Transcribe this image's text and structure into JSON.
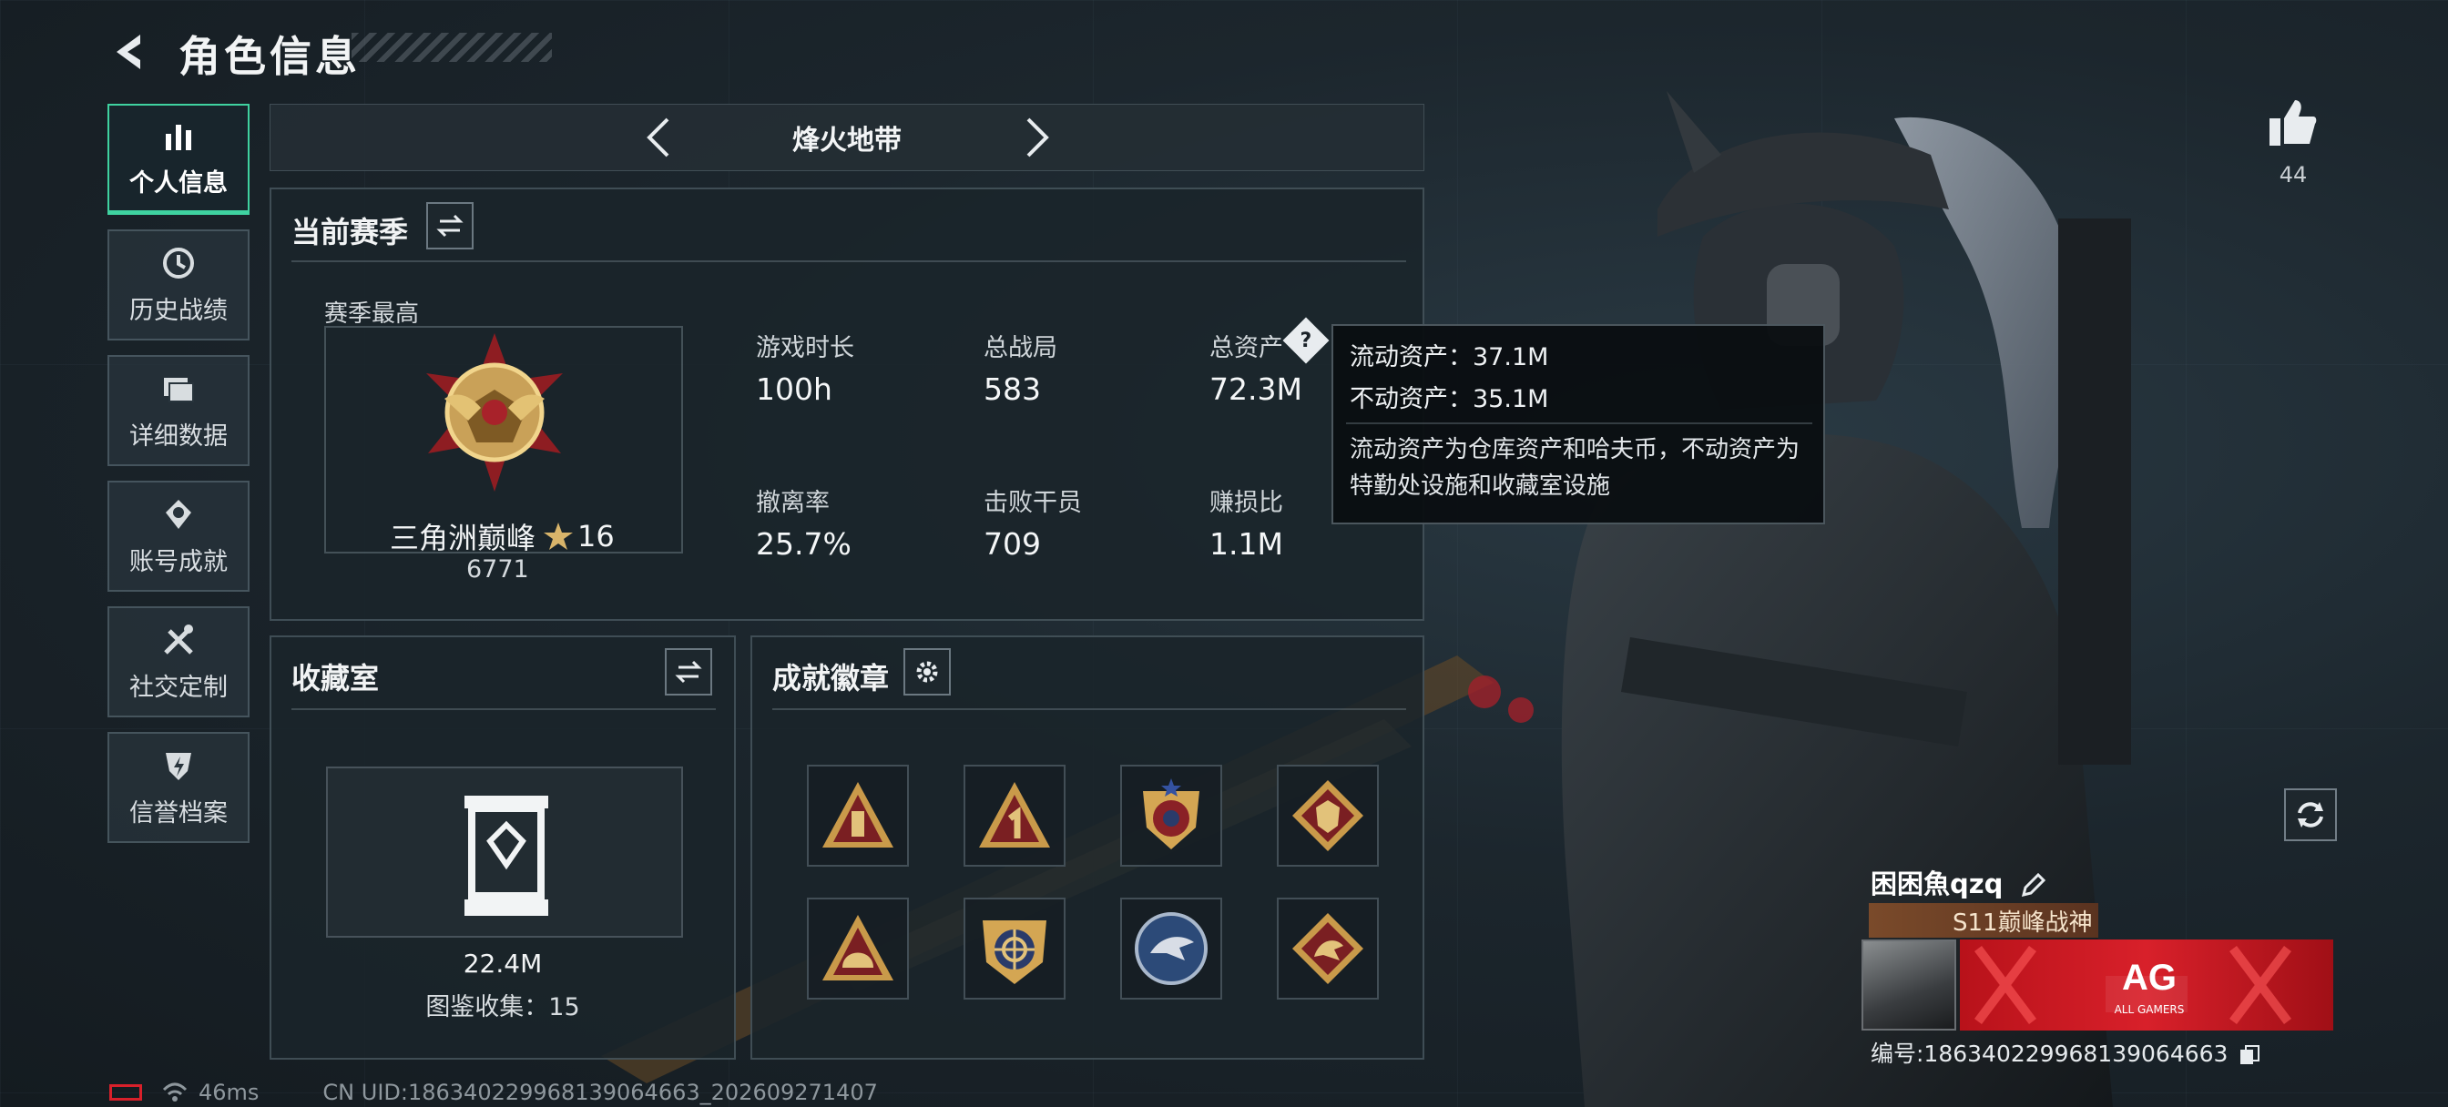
{
  "header": {
    "title": "角色信息"
  },
  "sidebar": {
    "items": [
      {
        "label": "个人信息",
        "icon": "bar-chart-icon",
        "active": true
      },
      {
        "label": "历史战绩",
        "icon": "history-clock-icon",
        "active": false
      },
      {
        "label": "详细数据",
        "icon": "folders-icon",
        "active": false
      },
      {
        "label": "账号成就",
        "icon": "achievement-icon",
        "active": false
      },
      {
        "label": "社交定制",
        "icon": "wrench-tools-icon",
        "active": false
      },
      {
        "label": "信誉档案",
        "icon": "reputation-shield-icon",
        "active": false
      }
    ]
  },
  "map_selector": {
    "current": "烽火地带"
  },
  "season": {
    "title": "当前赛季",
    "best_label": "赛季最高",
    "rank_name": "三角洲巅峰",
    "rank_stars": "16",
    "rank_score": "6771",
    "stats": [
      {
        "label": "游戏时长",
        "value": "100h"
      },
      {
        "label": "总战局",
        "value": "583"
      },
      {
        "label": "总资产",
        "value": "72.3M"
      },
      {
        "label": "撤离率",
        "value": "25.7%"
      },
      {
        "label": "击败干员",
        "value": "709"
      },
      {
        "label": "赚损比",
        "value": "1.1M"
      }
    ]
  },
  "tooltip": {
    "liquid": "流动资产：37.1M",
    "fixed": "不动资产：35.1M",
    "description": "流动资产为仓库资产和哈夫币，不动资产为特勤处设施和收藏室设施"
  },
  "collection": {
    "title": "收藏室",
    "value": "22.4M",
    "catalog": "图鉴收集：15"
  },
  "achievements": {
    "title": "成就徽章"
  },
  "player_card": {
    "likes": "44",
    "name": "困困魚qzq",
    "title_badge": "S11巅峰战神",
    "id_line": "编号:1863402299681390646​63",
    "banner_text": "AG",
    "banner_sub": "ALL GAMERS"
  },
  "status_bar": {
    "ping": "46ms",
    "uid": "CN UID:1863402299681390646​63_202609271407"
  },
  "colors": {
    "accent": "#3fd2a0",
    "banner_red": "#d8202a"
  }
}
